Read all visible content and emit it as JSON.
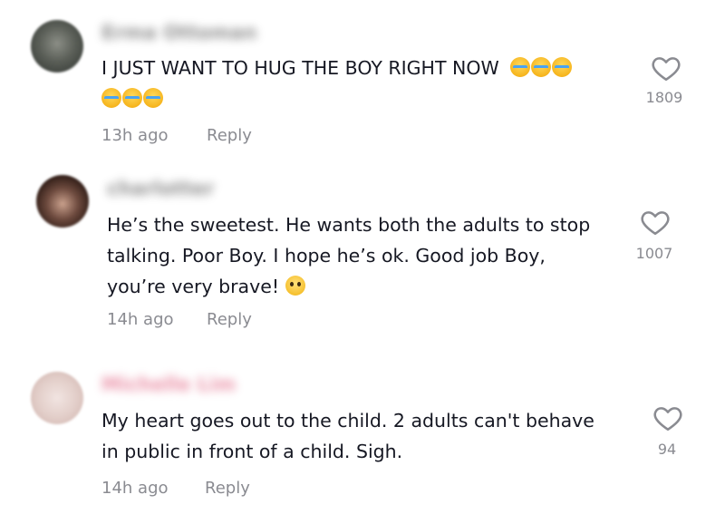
{
  "comments": [
    {
      "username": "Erma Ottoman",
      "lines": [
        "I JUST WANT TO HUG THE BOY RIGHT NOW"
      ],
      "emoji_line": "",
      "time": "13h ago",
      "reply_label": "Reply",
      "likes": "1809",
      "emojis_line1": [
        "loudly-crying-face",
        "loudly-crying-face",
        "loudly-crying-face"
      ],
      "emojis_line2": [
        "loudly-crying-face",
        "loudly-crying-face",
        "loudly-crying-face"
      ],
      "avatar_color": "#5b5f58"
    },
    {
      "username": "charlotter",
      "lines": [
        "He’s the sweetest. He wants both the adults to stop",
        "talking. Poor Boy. I hope he’s ok. Good job Boy,",
        "you’re very brave!"
      ],
      "time": "14h ago",
      "reply_label": "Reply",
      "likes": "1007",
      "emojis": [
        "pleading-face"
      ],
      "avatar_color": "#3a2620"
    },
    {
      "username": "Michelle Lim",
      "lines": [
        "My heart goes out to the child. 2 adults can't behave",
        "in public in front of a child. Sigh."
      ],
      "time": "14h ago",
      "reply_label": "Reply",
      "likes": "94",
      "avatar_color": "#e9d9d6"
    }
  ],
  "colors": {
    "text": "#161823",
    "meta": "#8a8b91",
    "username_c3": "#d9365e"
  },
  "icons": {
    "like": "heart-outline-icon"
  }
}
